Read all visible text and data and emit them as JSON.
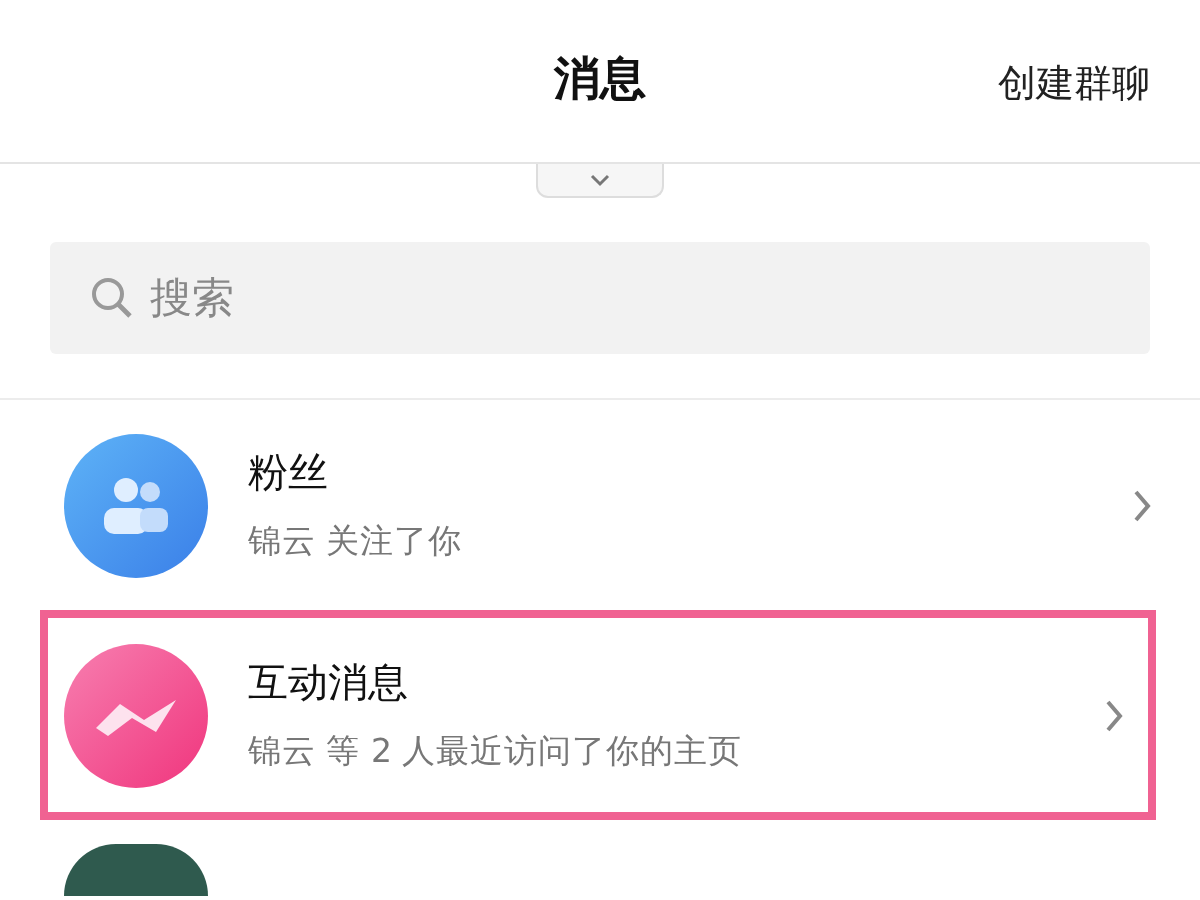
{
  "header": {
    "title": "消息",
    "action": "创建群聊"
  },
  "search": {
    "placeholder": "搜索"
  },
  "items": [
    {
      "kind": "fans",
      "title": "粉丝",
      "subtitle": "锦云 关注了你",
      "highlighted": false
    },
    {
      "kind": "interactions",
      "title": "互动消息",
      "subtitle": "锦云 等 2 人最近访问了你的主页",
      "highlighted": true
    },
    {
      "kind": "photo",
      "highlighted": false
    }
  ]
}
